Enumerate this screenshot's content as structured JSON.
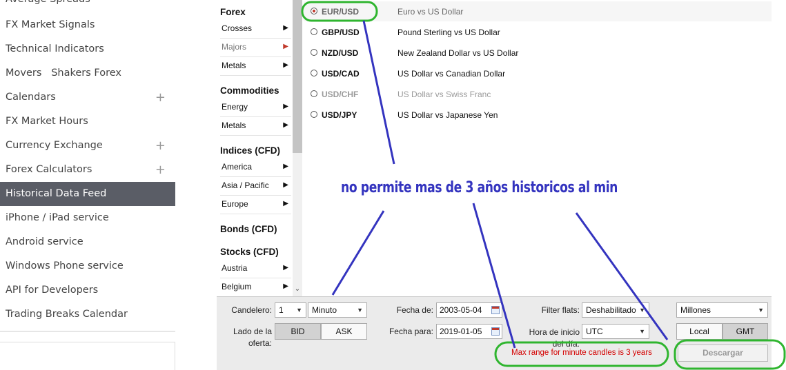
{
  "sidebar": {
    "items": [
      {
        "label": "Average Spreads",
        "plus": false,
        "active": false
      },
      {
        "label": "FX Market Signals",
        "plus": false,
        "active": false
      },
      {
        "label": "Technical Indicators",
        "plus": false,
        "active": false
      },
      {
        "label": "Movers   Shakers Forex",
        "plus": false,
        "active": false
      },
      {
        "label": "Calendars",
        "plus": true,
        "active": false
      },
      {
        "label": "FX Market Hours",
        "plus": false,
        "active": false
      },
      {
        "label": "Currency Exchange",
        "plus": true,
        "active": false
      },
      {
        "label": "Forex Calculators",
        "plus": true,
        "active": false
      },
      {
        "label": "Historical Data Feed",
        "plus": false,
        "active": true
      },
      {
        "label": "iPhone / iPad service",
        "plus": false,
        "active": false
      },
      {
        "label": "Android service",
        "plus": false,
        "active": false
      },
      {
        "label": "Windows Phone service",
        "plus": false,
        "active": false
      },
      {
        "label": "API for Developers",
        "plus": false,
        "active": false
      },
      {
        "label": "Trading Breaks Calendar",
        "plus": false,
        "active": false
      }
    ],
    "plus_symbol": "+"
  },
  "categories": {
    "forex": {
      "heading": "Forex",
      "items": [
        "Crosses",
        "Majors",
        "Metals"
      ]
    },
    "commodities": {
      "heading": "Commodities",
      "items": [
        "Energy",
        "Metals"
      ]
    },
    "indices": {
      "heading": "Indices (CFD)",
      "items": [
        "America",
        "Asia / Pacific",
        "Europe"
      ]
    },
    "bonds": {
      "heading": "Bonds (CFD)"
    },
    "stocks": {
      "heading": "Stocks (CFD)",
      "items": [
        "Austria",
        "Belgium"
      ]
    },
    "arrow": "▶"
  },
  "instruments": [
    {
      "symbol": "EUR/USD",
      "description": "Euro vs US Dollar",
      "selected": true,
      "disabled": false
    },
    {
      "symbol": "GBP/USD",
      "description": "Pound Sterling vs US Dollar",
      "selected": false,
      "disabled": false
    },
    {
      "symbol": "NZD/USD",
      "description": "New Zealand Dollar vs US Dollar",
      "selected": false,
      "disabled": false
    },
    {
      "symbol": "USD/CAD",
      "description": "US Dollar vs Canadian Dollar",
      "selected": false,
      "disabled": false
    },
    {
      "symbol": "USD/CHF",
      "description": "US Dollar vs Swiss Franc",
      "selected": false,
      "disabled": true
    },
    {
      "symbol": "USD/JPY",
      "description": "US Dollar vs Japanese Yen",
      "selected": false,
      "disabled": false
    }
  ],
  "controls": {
    "candelero_label": "Candelero:",
    "candle_count": "1",
    "candle_unit": "Minuto",
    "side_label": "Lado de la oferta:",
    "bid_label": "BID",
    "ask_label": "ASK",
    "from_label": "Fecha de:",
    "from_date": "2003-05-04",
    "to_label": "Fecha para:",
    "to_date": "2019-01-05",
    "flats_label": "Filter flats:",
    "flats_value": "Deshabilitado",
    "start_hour_label": "Hora de inicio del día:",
    "timezone_value": "UTC",
    "volume_units": "Millones",
    "local_label": "Local",
    "gmt_label": "GMT",
    "download_label": "Descargar",
    "warning": "Max range for minute candles is 3 years",
    "caret": "▼"
  },
  "annotation": {
    "text": "no permite mas de 3 años historicos al min",
    "color": "#3434bf",
    "highlight_color": "#2fb52f"
  },
  "colors": {
    "active_sidebar": "#5a5d66",
    "warning": "#d40000"
  }
}
